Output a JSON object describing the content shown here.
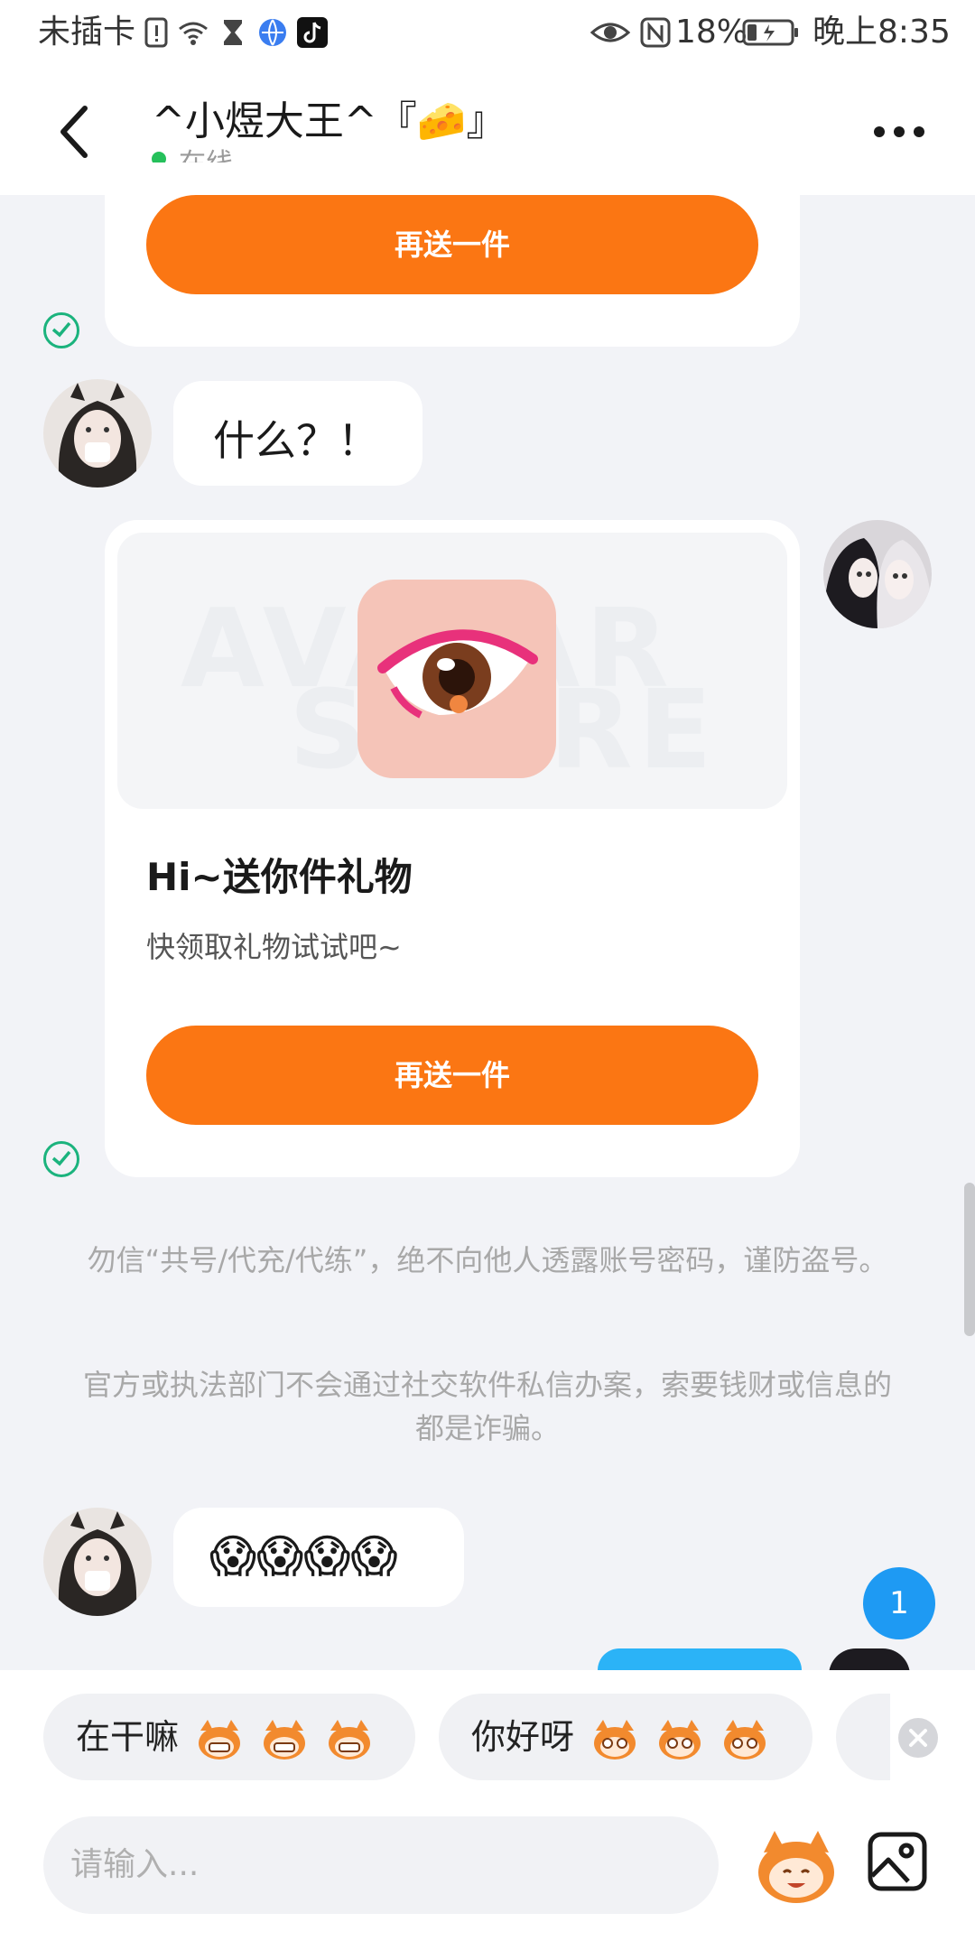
{
  "status_bar": {
    "carrier": "未插卡",
    "battery": "18%",
    "time": "晚上8:35"
  },
  "header": {
    "name": "^小煜大王^『🧀』",
    "status": "在线"
  },
  "messages": {
    "gift_button_top": "再送一件",
    "incoming_1": "什么？！",
    "gift_card": {
      "title": "Hi~送你件礼物",
      "subtitle": "快领取礼物试试吧~",
      "button": "再送一件"
    },
    "notice_1": "勿信“共号/代充/代练”，绝不向他人透露账号密码，谨防盗号。",
    "notice_2": "官方或执法部门不会通过社交软件私信办案，索要钱财或信息的都是诈骗。",
    "incoming_2_emoji": "😱😱😱😱"
  },
  "unread_count": "1",
  "quick_replies": [
    {
      "text": "在干嘛"
    },
    {
      "text": "你好呀"
    }
  ],
  "input": {
    "placeholder": "请输入..."
  },
  "colors": {
    "accent_orange": "#fb7613",
    "online_green": "#25c05b",
    "badge_blue": "#1e9af3",
    "background": "#f2f3f7"
  },
  "icons": [
    "back-arrow-icon",
    "more-icon",
    "check-circle-icon",
    "close-circle-icon",
    "emoji-mascot-icon",
    "image-icon",
    "wifi-icon",
    "eye-icon",
    "nfc-icon",
    "battery-icon"
  ]
}
